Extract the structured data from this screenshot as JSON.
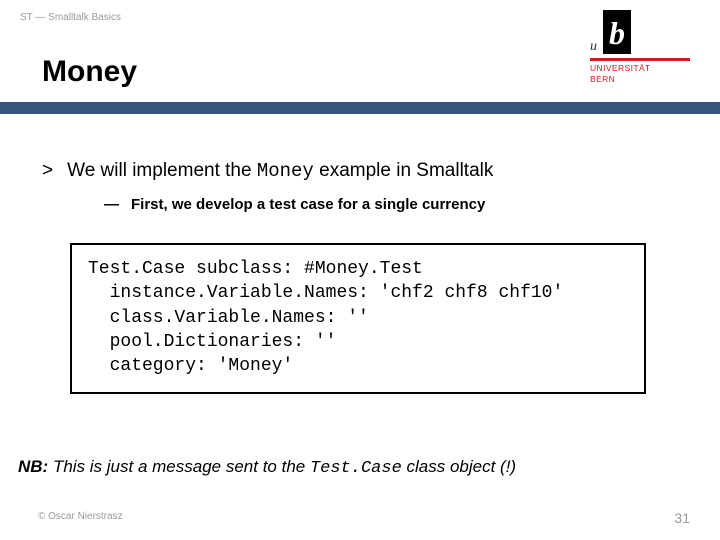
{
  "header": {
    "course_tag": "ST — Smalltalk Basics",
    "title": "Money",
    "logo": {
      "small_u": "u",
      "big_b": "b",
      "line1": "UNIVERSITÄT",
      "line2": "BERN"
    }
  },
  "bullet": {
    "symbol": ">",
    "pre": "We will implement the ",
    "mono": "Money",
    "post": " example in Smalltalk"
  },
  "sub_bullet": {
    "dash": "—",
    "text": "First, we develop a test case for a single currency"
  },
  "code": "Test.Case subclass: #Money.Test\n  instance.Variable.Names: 'chf2 chf8 chf10'\n  class.Variable.Names: ''\n  pool.Dictionaries: ''\n  category: 'Money'",
  "nb": {
    "label": "NB:",
    "pre": " This is just a message sent to the ",
    "mono": "Test.Case",
    "post": " class object (!)"
  },
  "footer": {
    "copyright": "© Oscar Nierstrasz",
    "page": "31"
  }
}
